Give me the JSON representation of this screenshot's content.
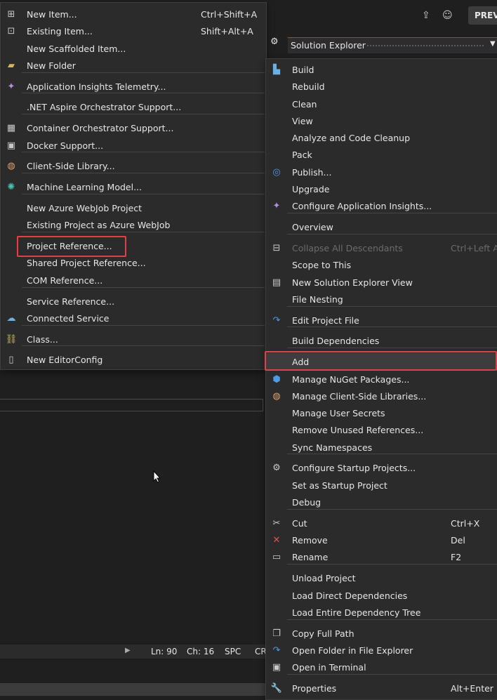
{
  "header": {
    "preview_label": "PREVI",
    "share_icon": "share-icon",
    "feedback_icon": "feedback-icon"
  },
  "solution_explorer": {
    "title": "Solution Explorer",
    "settings_icon": "gear-icon",
    "dropdown_icon": "chevron-down-icon"
  },
  "add_menu": {
    "items": [
      {
        "label": "New Item...",
        "shortcut": "Ctrl+Shift+A",
        "icon": "new-item-icon"
      },
      {
        "label": "Existing Item...",
        "shortcut": "Shift+Alt+A",
        "icon": "existing-item-icon"
      },
      {
        "label": "New Scaffolded Item...",
        "shortcut": "",
        "icon": ""
      },
      {
        "label": "New Folder",
        "shortcut": "",
        "icon": "folder-icon"
      },
      {
        "label": "Application Insights Telemetry...",
        "shortcut": "",
        "icon": "app-insights-icon"
      },
      {
        "label": ".NET Aspire Orchestrator Support...",
        "shortcut": "",
        "icon": ""
      },
      {
        "label": "Container Orchestrator Support...",
        "shortcut": "",
        "icon": "container-icon"
      },
      {
        "label": "Docker Support...",
        "shortcut": "",
        "icon": "docker-icon"
      },
      {
        "label": "Client-Side Library...",
        "shortcut": "",
        "icon": "client-library-icon"
      },
      {
        "label": "Machine Learning Model...",
        "shortcut": "",
        "icon": "ml-model-icon"
      },
      {
        "label": "New Azure WebJob Project",
        "shortcut": "",
        "icon": ""
      },
      {
        "label": "Existing Project as Azure WebJob",
        "shortcut": "",
        "icon": ""
      },
      {
        "label": "Project Reference...",
        "shortcut": "",
        "icon": ""
      },
      {
        "label": "Shared Project Reference...",
        "shortcut": "",
        "icon": ""
      },
      {
        "label": "COM Reference...",
        "shortcut": "",
        "icon": ""
      },
      {
        "label": "Service Reference...",
        "shortcut": "",
        "icon": ""
      },
      {
        "label": "Connected Service",
        "shortcut": "",
        "icon": "connected-service-icon"
      },
      {
        "label": "Class...",
        "shortcut": "",
        "icon": "class-icon"
      },
      {
        "label": "New EditorConfig",
        "shortcut": "",
        "icon": "file-icon"
      }
    ]
  },
  "context_menu": {
    "items": [
      {
        "label": "Build",
        "shortcut": "",
        "icon": "build-icon"
      },
      {
        "label": "Rebuild",
        "shortcut": "",
        "icon": ""
      },
      {
        "label": "Clean",
        "shortcut": "",
        "icon": ""
      },
      {
        "label": "View",
        "shortcut": "",
        "icon": ""
      },
      {
        "label": "Analyze and Code Cleanup",
        "shortcut": "",
        "icon": ""
      },
      {
        "label": "Pack",
        "shortcut": "",
        "icon": ""
      },
      {
        "label": "Publish...",
        "shortcut": "",
        "icon": "globe-icon"
      },
      {
        "label": "Upgrade",
        "shortcut": "",
        "icon": ""
      },
      {
        "label": "Configure Application Insights...",
        "shortcut": "",
        "icon": "app-insights-icon"
      },
      {
        "label": "Overview",
        "shortcut": "",
        "icon": ""
      },
      {
        "label": "Collapse All Descendants",
        "shortcut": "Ctrl+Left Ar",
        "icon": "collapse-icon"
      },
      {
        "label": "Scope to This",
        "shortcut": "",
        "icon": ""
      },
      {
        "label": "New Solution Explorer View",
        "shortcut": "",
        "icon": "window-icon"
      },
      {
        "label": "File Nesting",
        "shortcut": "",
        "icon": ""
      },
      {
        "label": "Edit Project File",
        "shortcut": "",
        "icon": "redo-arrow-icon"
      },
      {
        "label": "Build Dependencies",
        "shortcut": "",
        "icon": ""
      },
      {
        "label": "Add",
        "shortcut": "",
        "icon": ""
      },
      {
        "label": "Manage NuGet Packages...",
        "shortcut": "",
        "icon": "nuget-icon"
      },
      {
        "label": "Manage Client-Side Libraries...",
        "shortcut": "",
        "icon": "client-library-icon"
      },
      {
        "label": "Manage User Secrets",
        "shortcut": "",
        "icon": ""
      },
      {
        "label": "Remove Unused References...",
        "shortcut": "",
        "icon": ""
      },
      {
        "label": "Sync Namespaces",
        "shortcut": "",
        "icon": ""
      },
      {
        "label": "Configure Startup Projects...",
        "shortcut": "",
        "icon": "gear-icon"
      },
      {
        "label": "Set as Startup Project",
        "shortcut": "",
        "icon": ""
      },
      {
        "label": "Debug",
        "shortcut": "",
        "icon": ""
      },
      {
        "label": "Cut",
        "shortcut": "Ctrl+X",
        "icon": "scissors-icon"
      },
      {
        "label": "Remove",
        "shortcut": "Del",
        "icon": "x-icon"
      },
      {
        "label": "Rename",
        "shortcut": "F2",
        "icon": "rename-icon"
      },
      {
        "label": "Unload Project",
        "shortcut": "",
        "icon": ""
      },
      {
        "label": "Load Direct Dependencies",
        "shortcut": "",
        "icon": ""
      },
      {
        "label": "Load Entire Dependency Tree",
        "shortcut": "",
        "icon": ""
      },
      {
        "label": "Copy Full Path",
        "shortcut": "",
        "icon": "copy-icon"
      },
      {
        "label": "Open Folder in File Explorer",
        "shortcut": "",
        "icon": "redo-arrow-icon"
      },
      {
        "label": "Open in Terminal",
        "shortcut": "",
        "icon": "terminal-icon"
      },
      {
        "label": "Properties",
        "shortcut": "Alt+Enter",
        "icon": "wrench-icon"
      }
    ]
  },
  "status_bar": {
    "line": "Ln: 90",
    "char": "Ch: 16",
    "spc": "SPC",
    "cr": "CR"
  }
}
